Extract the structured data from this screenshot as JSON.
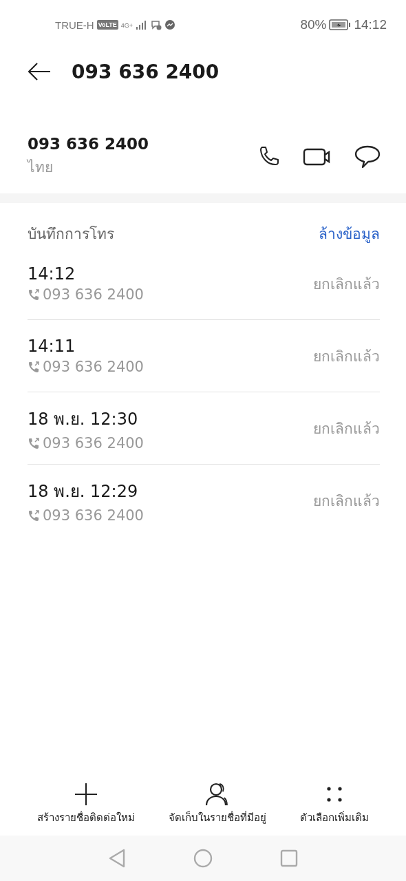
{
  "status_bar": {
    "carrier": "TRUE-H",
    "volte": "VoLTE",
    "network": "4G+",
    "battery": "80%",
    "time": "14:12"
  },
  "header": {
    "title": "093 636 2400"
  },
  "contact": {
    "number": "093 636 2400",
    "location": "ไทย"
  },
  "call_log": {
    "title": "บันทึกการโทร",
    "clear_link": "ล้างข้อมูล",
    "rows": [
      {
        "time": "14:12",
        "number": "093 636 2400",
        "status": "ยกเลิกแล้ว"
      },
      {
        "time": "14:11",
        "number": "093 636 2400",
        "status": "ยกเลิกแล้ว"
      },
      {
        "time": "18 พ.ย. 12:30",
        "number": "093 636 2400",
        "status": "ยกเลิกแล้ว"
      },
      {
        "time": "18 พ.ย. 12:29",
        "number": "093 636 2400",
        "status": "ยกเลิกแล้ว"
      }
    ]
  },
  "actions": [
    {
      "kind": "add",
      "label": "สร้างรายชื่อติดต่อใหม่"
    },
    {
      "kind": "contact",
      "label": "จัดเก็บในรายชื่อที่มีอยู่"
    },
    {
      "kind": "more",
      "label": "ตัวเลือกเพิ่มเติม"
    }
  ]
}
